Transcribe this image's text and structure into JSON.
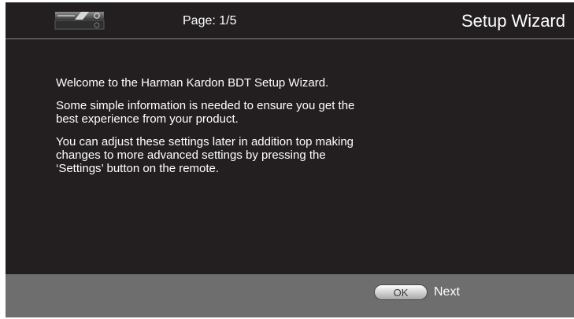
{
  "header": {
    "page_indicator": "Page: 1/5",
    "title": "Setup Wizard",
    "device_icon": "bluray-player-icon"
  },
  "main": {
    "paragraphs": [
      "Welcome to the Harman Kardon BDT Setup Wizard.",
      "Some simple information is needed to ensure you get the best experience from your product.",
      "You can adjust these settings later in addition top making changes to more advanced settings by pressing the ‘Settings’ button on the remote."
    ]
  },
  "footer": {
    "ok_label": "OK",
    "next_label": "Next"
  },
  "colors": {
    "screen_background": "#231f20",
    "footer_background": "#6e6e6e",
    "text": "#ffffff"
  }
}
